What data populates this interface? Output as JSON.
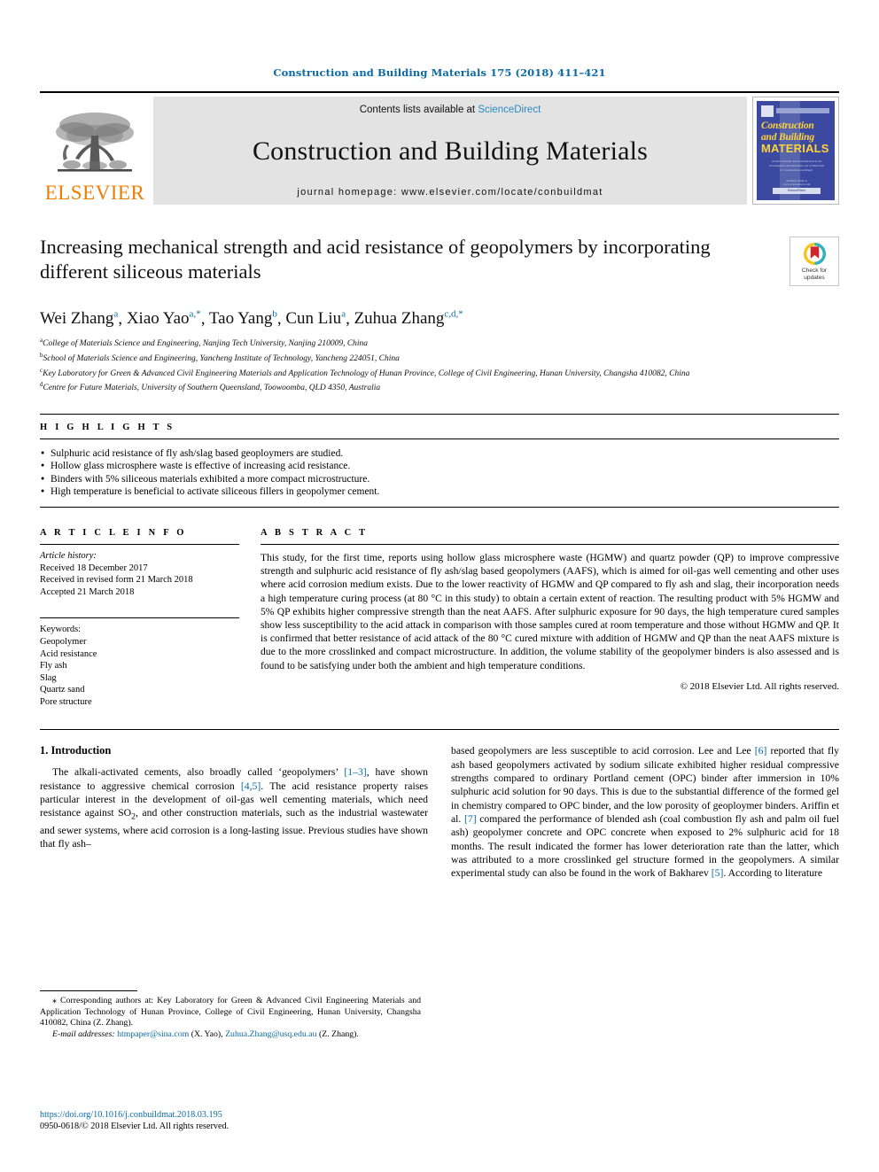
{
  "running_head": "Construction and Building Materials 175 (2018) 411–421",
  "masthead": {
    "publisher_wordmark": "ELSEVIER",
    "contents_prefix": "Contents lists available at ",
    "contents_link": "ScienceDirect",
    "journal_title": "Construction and Building Materials",
    "homepage_label": "journal homepage: www.elsevier.com/locate/conbuildmat",
    "cover": {
      "line1": "Construction",
      "line2": "and Building",
      "line3": "MATERIALS",
      "subtitle": "An International Journal dedicated to the Investigation and Innovative use of Materials in Construction and Repair",
      "foot_note": "Available online at www.sciencedirect.com",
      "foot_box": "ScienceDirect"
    }
  },
  "article": {
    "title": "Increasing mechanical strength and acid resistance of geopolymers by incorporating different siliceous materials",
    "crossmark_line1": "Check for",
    "crossmark_line2": "updates",
    "authors": [
      {
        "name": "Wei Zhang",
        "sup": "a",
        "sep": ", "
      },
      {
        "name": "Xiao Yao",
        "sup": "a,*",
        "sep": ", "
      },
      {
        "name": "Tao Yang",
        "sup": "b",
        "sep": ", "
      },
      {
        "name": "Cun Liu",
        "sup": "a",
        "sep": ", "
      },
      {
        "name": "Zuhua Zhang",
        "sup": "c,d,*",
        "sep": ""
      }
    ],
    "affiliations": [
      {
        "mark": "a",
        "text": "College of Materials Science and Engineering, Nanjing Tech University, Nanjing 210009, China"
      },
      {
        "mark": "b",
        "text": "School of Materials Science and Engineering, Yancheng Institute of Technology, Yancheng 224051, China"
      },
      {
        "mark": "c",
        "text": "Key Laboratory for Green & Advanced Civil Engineering Materials and Application Technology of Hunan Province, College of Civil Engineering, Hunan University, Changsha 410082, China"
      },
      {
        "mark": "d",
        "text": "Centre for Future Materials, University of Southern Queensland, Toowoomba, QLD 4350, Australia"
      }
    ]
  },
  "highlights": {
    "label": "H I G H L I G H T S",
    "items": [
      "Sulphuric acid resistance of fly ash/slag based geoploymers are studied.",
      "Hollow glass microsphere waste is effective of increasing acid resistance.",
      "Binders with 5% siliceous materials exhibited a more compact microstructure.",
      "High temperature is beneficial to activate siliceous fillers in geopolymer cement."
    ]
  },
  "article_info": {
    "label": "A R T I C L E   I N F O",
    "history_label": "Article history:",
    "history": [
      "Received 18 December 2017",
      "Received in revised form 21 March 2018",
      "Accepted 21 March 2018"
    ],
    "keywords_label": "Keywords:",
    "keywords": [
      "Geopolymer",
      "Acid resistance",
      "Fly ash",
      "Slag",
      "Quartz sand",
      "Pore structure"
    ]
  },
  "abstract": {
    "label": "A B S T R A C T",
    "text": "This study, for the first time, reports using hollow glass microsphere waste (HGMW) and quartz powder (QP) to improve compressive strength and sulphuric acid resistance of fly ash/slag based geopolymers (AAFS), which is aimed for oil-gas well cementing and other uses where acid corrosion medium exists. Due to the lower reactivity of HGMW and QP compared to fly ash and slag, their incorporation needs a high temperature curing process (at 80 °C in this study) to obtain a certain extent of reaction. The resulting product with 5% HGMW and 5% QP exhibits higher compressive strength than the neat AAFS. After sulphuric exposure for 90 days, the high temperature cured samples show less susceptibility to the acid attack in comparison with those samples cured at room temperature and those without HGMW and QP. It is confirmed that better resistance of acid attack of the 80 °C cured mixture with addition of HGMW and QP than the neat AAFS mixture is due to the more crosslinked and compact microstructure. In addition, the volume stability of the geopolymer binders is also assessed and is found to be satisfying under both the ambient and high temperature conditions.",
    "copyright": "© 2018 Elsevier Ltd. All rights reserved."
  },
  "introduction": {
    "heading": "1. Introduction",
    "left_paragraph_part1": "The alkali-activated cements, also broadly called ‘geopolymers’ ",
    "cite_1_3": "[1–3]",
    "left_paragraph_part2": ", have shown resistance to aggressive chemical corrosion ",
    "cite_4_5": "[4,5]",
    "left_paragraph_part3": ". The acid resistance property raises particular interest in the development of oil-gas well cementing materials, which need resistance against SO",
    "so2_sub": "2",
    "left_paragraph_part4": ", and other construction materials, such as the industrial wastewater and sewer systems, where acid corrosion is a long-lasting issue. Previous studies have shown that fly ash–",
    "right_part1": "based geopolymers are less susceptible to acid corrosion. Lee and Lee ",
    "cite_6": "[6]",
    "right_part2": " reported that fly ash based geopolymers activated by sodium silicate exhibited higher residual compressive strengths compared to ordinary Portland cement (OPC) binder after immersion in 10% sulphuric acid solution for 90 days. This is due to the substantial difference of the formed gel in chemistry compared to OPC binder, and the low porosity of geoploymer binders. Ariffin et al. ",
    "cite_7": "[7]",
    "right_part3": " compared the performance of blended ash (coal combustion fly ash and palm oil fuel ash) geopolymer concrete and OPC concrete when exposed to 2% sulphuric acid for 18 months. The result indicated the former has lower deterioration rate than the latter, which was attributed to a more crosslinked gel structure formed in the geopolymers. A similar experimental study can also be found in the work of Bakharev ",
    "cite_5b": "[5]",
    "right_part4": ". According to literature"
  },
  "footnotes": {
    "corresponding": "⁎ Corresponding authors at: Key Laboratory for Green & Advanced Civil Engineering Materials and Application Technology of Hunan Province, College of Civil Engineering, Hunan University, Changsha 410082, China (Z. Zhang).",
    "email_label": "E-mail addresses:",
    "email1": "htmpaper@sina.com",
    "email1_owner": "(X. Yao)",
    "email2": "Zuhua.Zhang@usq.edu.au",
    "email2_owner": "(Z. Zhang)."
  },
  "doi": {
    "link": "https://doi.org/10.1016/j.conbuildmat.2018.03.195",
    "issn_line": "0950-0618/© 2018 Elsevier Ltd. All rights reserved."
  },
  "colors": {
    "link_blue": "#0b6aa2",
    "sciencedirect_blue": "#2a8bc4",
    "elsevier_orange": "#f07d00",
    "banner_grey": "#e3e3e3",
    "cover_blue": "#3b4aa0",
    "cover_yellow": "#ffd23a"
  }
}
